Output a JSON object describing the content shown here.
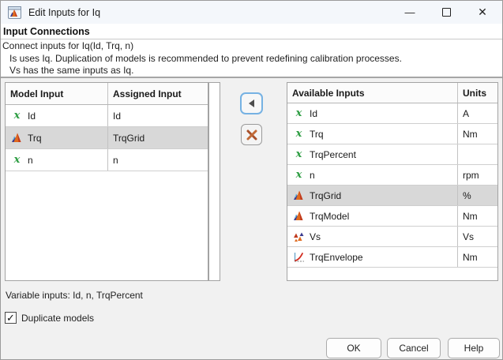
{
  "window": {
    "title": "Edit Inputs for Iq"
  },
  "header": {
    "section_title": "Input Connections"
  },
  "description": {
    "line1": "Connect inputs for Iq(Id, Trq, n)",
    "line2": "Is uses Iq. Duplication of models is recommended to prevent redefining calibration processes.",
    "line3": "Vs has the same inputs as Iq."
  },
  "left_table": {
    "columns": {
      "model_input": "Model Input",
      "assigned_input": "Assigned Input"
    },
    "rows": [
      {
        "icon": "variable-x-icon",
        "model_input": "Id",
        "assigned_input": "Id",
        "selected": false
      },
      {
        "icon": "matlab-model-icon",
        "model_input": "Trq",
        "assigned_input": "TrqGrid",
        "selected": true
      },
      {
        "icon": "variable-x-icon",
        "model_input": "n",
        "assigned_input": "n",
        "selected": false
      }
    ]
  },
  "right_table": {
    "columns": {
      "available_inputs": "Available Inputs",
      "units": "Units"
    },
    "rows": [
      {
        "icon": "variable-x-icon",
        "name": "Id",
        "units": "A",
        "selected": false
      },
      {
        "icon": "variable-x-icon",
        "name": "Trq",
        "units": "Nm",
        "selected": false
      },
      {
        "icon": "variable-x-icon",
        "name": "TrqPercent",
        "units": "",
        "selected": false
      },
      {
        "icon": "variable-x-icon",
        "name": "n",
        "units": "rpm",
        "selected": false
      },
      {
        "icon": "matlab-model-icon",
        "name": "TrqGrid",
        "units": "%",
        "selected": true
      },
      {
        "icon": "matlab-model-icon",
        "name": "TrqModel",
        "units": "Nm",
        "selected": false
      },
      {
        "icon": "pointcloud-model-icon",
        "name": "Vs",
        "units": "Vs",
        "selected": false
      },
      {
        "icon": "envelope-plot-icon",
        "name": "TrqEnvelope",
        "units": "Nm",
        "selected": false
      }
    ]
  },
  "footer": {
    "variable_inputs": "Variable inputs: Id, n, TrqPercent",
    "duplicate_models_label": "Duplicate models",
    "duplicate_models_checked": true,
    "checkmark": "✓",
    "ok": "OK",
    "cancel": "Cancel",
    "help": "Help"
  },
  "titlebar_glyphs": {
    "minimize": "—"
  },
  "colors": {
    "selection": "#d8d8d8",
    "focus_border": "#76b2e3",
    "variable_green": "#2f9e44",
    "matlab_orange": "#e06b1f",
    "matlab_red": "#c03a1e"
  }
}
